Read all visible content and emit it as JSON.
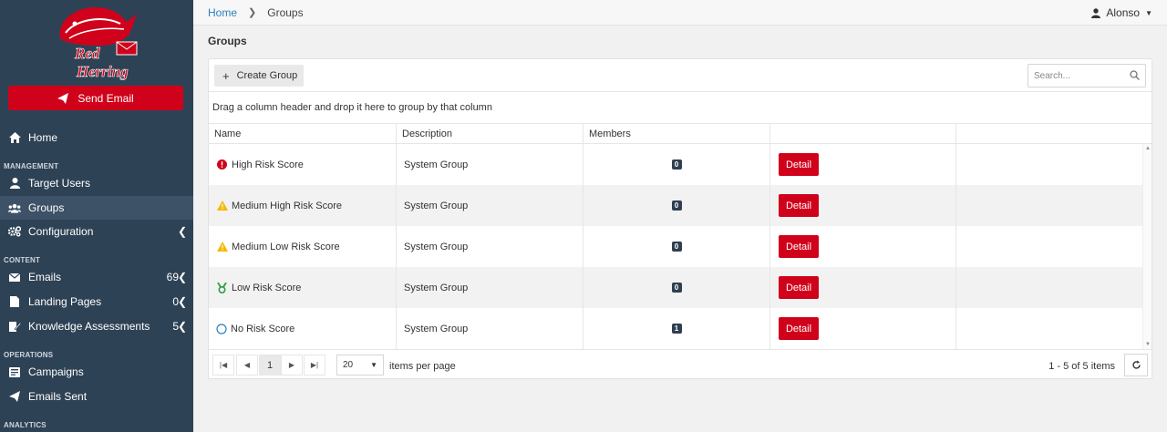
{
  "sidebar": {
    "logo_text_1": "Red",
    "logo_text_2": "Herring",
    "send_email": "Send Email",
    "home": "Home",
    "section_management": "MANAGEMENT",
    "target_users": "Target Users",
    "groups": "Groups",
    "configuration": "Configuration",
    "section_content": "CONTENT",
    "emails": "Emails",
    "emails_count": "69",
    "landing_pages": "Landing Pages",
    "landing_pages_count": "0",
    "knowledge": "Knowledge Assessments",
    "knowledge_count": "5",
    "section_operations": "OPERATIONS",
    "campaigns": "Campaigns",
    "emails_sent": "Emails Sent",
    "section_analytics": "ANALYTICS",
    "accent_color": "#d0021b"
  },
  "topbar": {
    "home": "Home",
    "current": "Groups",
    "user": "Alonso"
  },
  "page": {
    "title": "Groups"
  },
  "toolbar": {
    "create_group": "Create Group",
    "search_placeholder": "Search..."
  },
  "grid": {
    "group_hint": "Drag a column header and drop it here to group by that column",
    "columns": [
      "Name",
      "Description",
      "Members",
      "",
      ""
    ],
    "rows": [
      {
        "name": "High Risk Score",
        "description": "System Group",
        "members": "0",
        "action": "Detail",
        "icon": "error-circle-icon"
      },
      {
        "name": "Medium High Risk Score",
        "description": "System Group",
        "members": "0",
        "action": "Detail",
        "icon": "warning-triangle-icon"
      },
      {
        "name": "Medium Low Risk Score",
        "description": "System Group",
        "members": "0",
        "action": "Detail",
        "icon": "warning-triangle-icon"
      },
      {
        "name": "Low Risk Score",
        "description": "System Group",
        "members": "0",
        "action": "Detail",
        "icon": "medal-icon"
      },
      {
        "name": "No Risk Score",
        "description": "System Group",
        "members": "1",
        "action": "Detail",
        "icon": "empty-circle-icon"
      }
    ]
  },
  "pager": {
    "current_page": "1",
    "page_size": "20",
    "per_page_label": "items per page",
    "items_info": "1 - 5 of 5 items"
  }
}
